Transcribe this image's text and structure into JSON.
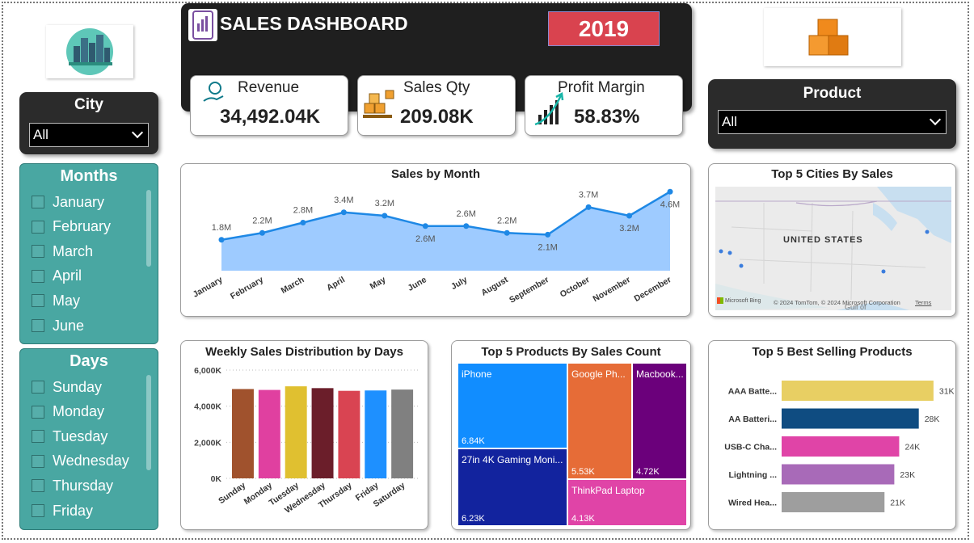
{
  "header": {
    "title": "SALES DASHBOARD",
    "year": "2019"
  },
  "kpis": [
    {
      "title": "Revenue",
      "value": "34,492.04K"
    },
    {
      "title": "Sales Qty",
      "value": "209.08K"
    },
    {
      "title": "Profit Margin",
      "value": "58.83%"
    }
  ],
  "city_filter": {
    "label": "City",
    "selected": "All"
  },
  "product_filter": {
    "label": "Product",
    "selected": "All"
  },
  "months_slicer": {
    "title": "Months",
    "items": [
      "January",
      "February",
      "March",
      "April",
      "May",
      "June"
    ]
  },
  "days_slicer": {
    "title": "Days",
    "items": [
      "Sunday",
      "Monday",
      "Tuesday",
      "Wednesday",
      "Thursday",
      "Friday"
    ]
  },
  "map": {
    "title": "Top 5 Cities By Sales",
    "country_label": "UNITED STATES",
    "bing": "Microsoft Bing",
    "credit": "© 2024 TomTom, © 2024 Microsoft Corporation",
    "terms": "Terms",
    "gulf": "Gulf of"
  },
  "colors": {
    "teal": "#49a7a2",
    "year_badge": "#d9434f",
    "line": "#1e88e5",
    "area": "#9ecbff"
  },
  "chart_data": [
    {
      "type": "area",
      "title": "Sales by Month",
      "categories": [
        "January",
        "February",
        "March",
        "April",
        "May",
        "June",
        "July",
        "August",
        "September",
        "October",
        "November",
        "December"
      ],
      "values": [
        1.8,
        2.2,
        2.8,
        3.4,
        3.2,
        2.6,
        2.6,
        2.2,
        2.1,
        3.7,
        3.2,
        4.6
      ],
      "labels": [
        "1.8M",
        "2.2M",
        "2.8M",
        "3.4M",
        "3.2M",
        "2.6M",
        "2.6M",
        "2.2M",
        "2.1M",
        "3.7M",
        "3.2M",
        "4.6M"
      ],
      "label_pos": [
        "above",
        "above",
        "above",
        "above",
        "above",
        "below",
        "above",
        "above",
        "below",
        "above",
        "below",
        "below"
      ],
      "ylim": [
        0,
        4.8
      ]
    },
    {
      "type": "bar",
      "title": "Weekly Sales Distribution by Days",
      "categories": [
        "Sunday",
        "Monday",
        "Tuesday",
        "Wednesday",
        "Thursday",
        "Friday",
        "Saturday"
      ],
      "values": [
        4950,
        4900,
        5100,
        5000,
        4850,
        4870,
        4920
      ],
      "colors": [
        "#a0522d",
        "#e040a0",
        "#e0c030",
        "#6b1e2a",
        "#d94452",
        "#1e90ff",
        "#808080"
      ],
      "yticks": [
        "0K",
        "2,000K",
        "4,000K",
        "6,000K"
      ],
      "ytick_values": [
        0,
        2000,
        4000,
        6000
      ],
      "ylim": [
        0,
        6000
      ]
    },
    {
      "type": "treemap",
      "title": "Top 5 Products By Sales Count",
      "items": [
        {
          "name": "iPhone",
          "value": "6.84K",
          "color": "#118dff"
        },
        {
          "name": "27in 4K Gaming Moni...",
          "value": "6.23K",
          "color": "#12239e"
        },
        {
          "name": "Google Ph...",
          "value": "5.53K",
          "color": "#e66c37"
        },
        {
          "name": "Macbook...",
          "value": "4.72K",
          "color": "#6b007b"
        },
        {
          "name": "ThinkPad Laptop",
          "value": "4.13K",
          "color": "#e044a7"
        }
      ]
    },
    {
      "type": "bar",
      "orientation": "horizontal",
      "title": "Top 5 Best Selling Products",
      "categories": [
        "AAA Batte...",
        "AA Batteri...",
        "USB-C Cha...",
        "Lightning ...",
        "Wired Hea..."
      ],
      "values": [
        31,
        28,
        24,
        23,
        21
      ],
      "labels": [
        "31K",
        "28K",
        "24K",
        "23K",
        "21K"
      ],
      "colors": [
        "#e8cf63",
        "#0f4c81",
        "#e044a7",
        "#a86ab8",
        "#9e9e9e"
      ],
      "xlim": [
        0,
        33
      ]
    }
  ]
}
